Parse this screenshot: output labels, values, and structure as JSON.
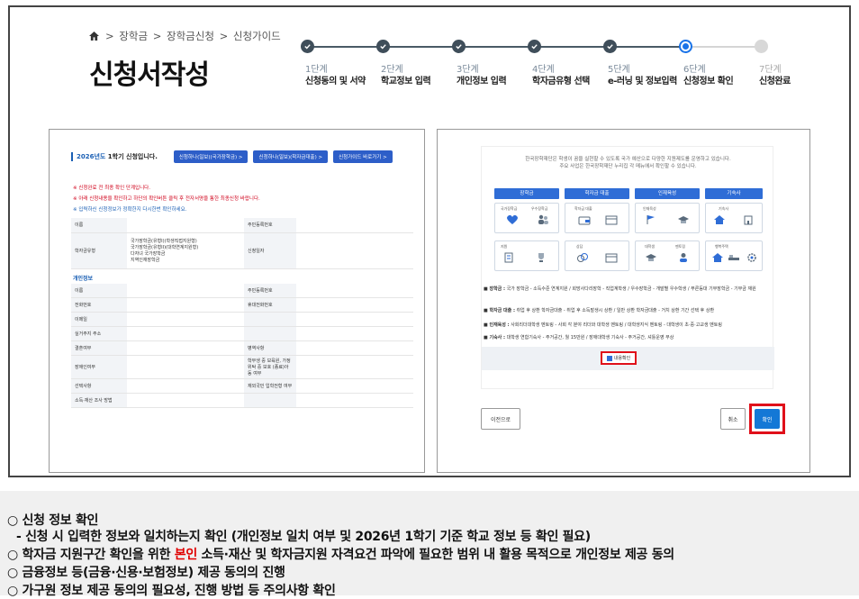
{
  "breadcrumb": [
    "장학금",
    "장학금신청",
    "신청가이드"
  ],
  "page_title": "신청서작성",
  "steps": [
    {
      "num": "1단계",
      "label": "신청동의 및 서약",
      "state": "done"
    },
    {
      "num": "2단계",
      "label": "학교정보 입력",
      "state": "done"
    },
    {
      "num": "3단계",
      "label": "개인정보 입력",
      "state": "done"
    },
    {
      "num": "4단계",
      "label": "학자금유형 선택",
      "state": "done"
    },
    {
      "num": "5단계",
      "label": "e-러닝 및 정보입력",
      "state": "done"
    },
    {
      "num": "6단계",
      "label": "신청정보 확인",
      "state": "current"
    },
    {
      "num": "7단계",
      "label": "신청완료",
      "state": "todo"
    }
  ],
  "left_form": {
    "header_year": "2026년도",
    "header_rest": " 1학기 신청입니다.",
    "buttons": [
      "신청하나(일보)(국가장학금) >",
      "신청하나(일보)(학자금대출) >",
      "신청가이드 바로가기 >"
    ],
    "warnings": [
      "※ 신청완료 전 최종 확인 단계입니다.",
      "※ 아래 신청내용을 확인하고 하단의 확인버튼 클릭 후 전자서명을 통한 최종신청 바랍니다."
    ],
    "note": "※ 입력하신 신청정보가 정확한지 다시한번 확인하세요.",
    "rows1": [
      {
        "k": "이름",
        "v": "",
        "k2": "주민등록번호",
        "v2": ""
      },
      {
        "k": "학자금유형",
        "v": "국가장학금(유형I)(학생직접지원형)\n국가장학금(유형II)(대학연계지원형)\n다자녀 국가장학금\n지역인재장학금",
        "k2": "신청일자",
        "v2": ""
      }
    ],
    "section_personal": "개인정보",
    "rows2": [
      {
        "k": "이름",
        "v": "",
        "k2": "주민등록번호",
        "v2": ""
      },
      {
        "k": "전화번호",
        "v": "",
        "k2": "휴대전화번호",
        "v2": ""
      },
      {
        "k": "이메일",
        "v": "",
        "k2": "",
        "v2": ""
      },
      {
        "k": "실거주지 주소",
        "v": "",
        "k2": "",
        "v2": ""
      },
      {
        "k": "결혼여부",
        "v": "",
        "k2": "병역사항",
        "v2": ""
      },
      {
        "k": "장애인여부",
        "v": "",
        "k2": "학부생 중 보육원, 가정위탁 중 보호 (종료)아동 여부",
        "v2": ""
      },
      {
        "k": "선택사항",
        "v": "",
        "k2": "재외국민 입학전형 여부",
        "v2": ""
      },
      {
        "k": "소득·재산 조사 방법",
        "v": "",
        "k2": "",
        "v2": ""
      }
    ]
  },
  "right_panel": {
    "intro": [
      "한국장학재단은 학생이 꿈을 실현할 수 있도록 국가 예산으로 다양한 지원제도를 운영하고 있습니다.",
      "주요 사업은 한국장학재단 누리집 각 메뉴에서 확인할 수 있습니다."
    ],
    "categories": [
      "장학금",
      "학자금 대출",
      "인재육성",
      "기숙사"
    ],
    "box_labels": [
      "국가장학금",
      "우수장학금",
      "학자금 대출",
      "인재육성",
      "기숙사",
      "지원",
      "상담",
      "대학생",
      "멘토링",
      "행복주택"
    ],
    "bullets": [
      {
        "b": "■ 장학금 :",
        "t": " 국가 장학금 - 소득수준 연계지원 / 희망사다리장학 - 직업계학생 / 우수장학금 - 개발별 우수학생 / 푸른등대 기부장학금 - 기부금 재원"
      },
      {
        "b": "■ 학자금 대출 :",
        "t": " 취업 후 상환 학자금대출 - 취업 후 소득발생시 상환 / 일반 상환 학자금대출 - 거치 상환 기간 선택 후 상환"
      },
      {
        "b": "■ 인재육성 :",
        "t": " 사회리더대학생 멘토링 - 사회 각 분야 리더와 대학생 멘토링 / 대학생지식 멘토링 - 대학생이 초·중·고교생 멘토링"
      },
      {
        "b": "■ 기숙사 :",
        "t": " 대학생 연합기숙사 - 주거공간, 월 15만원 / 장애대학생 기숙사 - 주거공간, 셔틀운영 무상"
      }
    ],
    "agree_label": "내용확인",
    "prev_label": "이전으로",
    "cancel_label": "취소",
    "ok_label": "확인"
  },
  "bottom_notes": {
    "l1": "○ 신청 정보 확인",
    "l2": "- 신청 시 입력한 정보와 일치하는지 확인 (개인정보 일치 여부 및 2026년 1학기 기준 학교 정보 등 확인 필요)",
    "l3a": "○ 학자금 지원구간 확인을 위한 ",
    "l3b": "본인",
    "l3c": " 소득·재산 및 학자금지원 자격요건 파악에 필요한 범위 내 활용 목적으로 개인정보 제공 동의",
    "l4": "○ 금융정보 등(금융·신용·보험정보) 제공 동의의 진행",
    "l5": "○ 가구원 정보 제공 동의의 필요성, 진행 방법 등 주의사항 확인"
  },
  "colors": {
    "accent": "#1a73e8",
    "highlight": "#e0101a",
    "primary_btn": "#1478d6"
  }
}
